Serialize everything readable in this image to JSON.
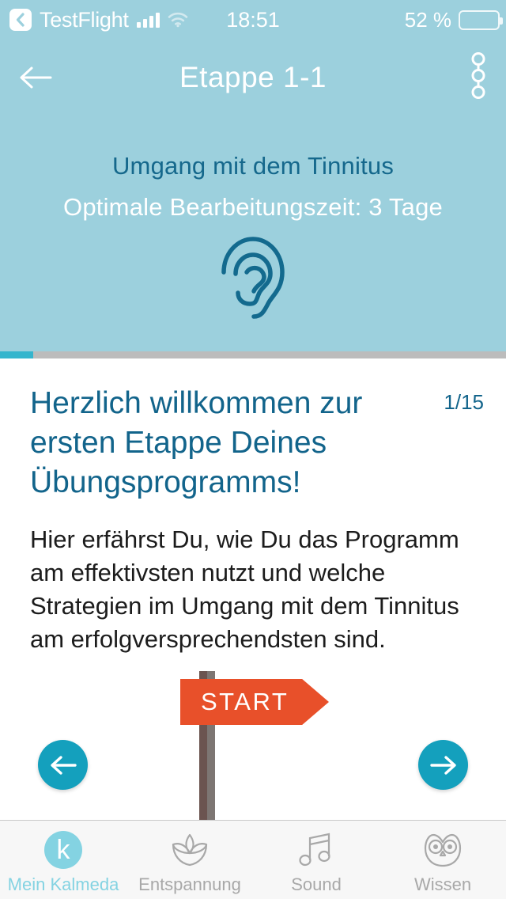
{
  "statusbar": {
    "back_label": "TestFlight",
    "back_icon": "chevron-left-icon",
    "signal_icon": "cellular-signal-icon",
    "wifi_icon": "wifi-icon",
    "time": "18:51",
    "battery_percent": "52 %",
    "battery_level": 52
  },
  "navbar": {
    "back_icon": "arrow-left-icon",
    "title": "Etappe 1-1",
    "menu_icon": "three-dots-chain-icon"
  },
  "hero": {
    "title": "Umgang mit dem Tinnitus",
    "subtitle": "Optimale Bearbeitungszeit: 3 Tage",
    "icon": "ear-icon",
    "background_color": "#9cd0dd",
    "title_color": "#15688c"
  },
  "progress": {
    "percent": 6.6,
    "fill_color": "#35b5cd",
    "track_color": "#bcbcbc"
  },
  "content": {
    "page_counter": "1/15",
    "headline": "Herzlich willkommen zur ersten Etappe Deines Übungsprogramms!",
    "body": "Hier erfährst Du, wie Du das Programm am effektivsten nutzt und welche Strategien im Umgang mit dem Tinnitus am erfolgversprechendsten sind.",
    "signpost": {
      "label": "START",
      "sign_color": "#e8502a",
      "post_color": "#6b5450"
    },
    "prev_button_icon": "arrow-left-icon",
    "next_button_icon": "arrow-right-icon",
    "button_color": "#14a0bd"
  },
  "tabbar": {
    "items": [
      {
        "label": "Mein Kalmeda",
        "icon": "kalmeda-logo-icon",
        "active": true
      },
      {
        "label": "Entspannung",
        "icon": "lotus-flower-icon",
        "active": false
      },
      {
        "label": "Sound",
        "icon": "music-note-icon",
        "active": false
      },
      {
        "label": "Wissen",
        "icon": "owl-icon",
        "active": false
      }
    ],
    "active_color": "#84d3e2",
    "inactive_color": "#a8a8a8"
  }
}
